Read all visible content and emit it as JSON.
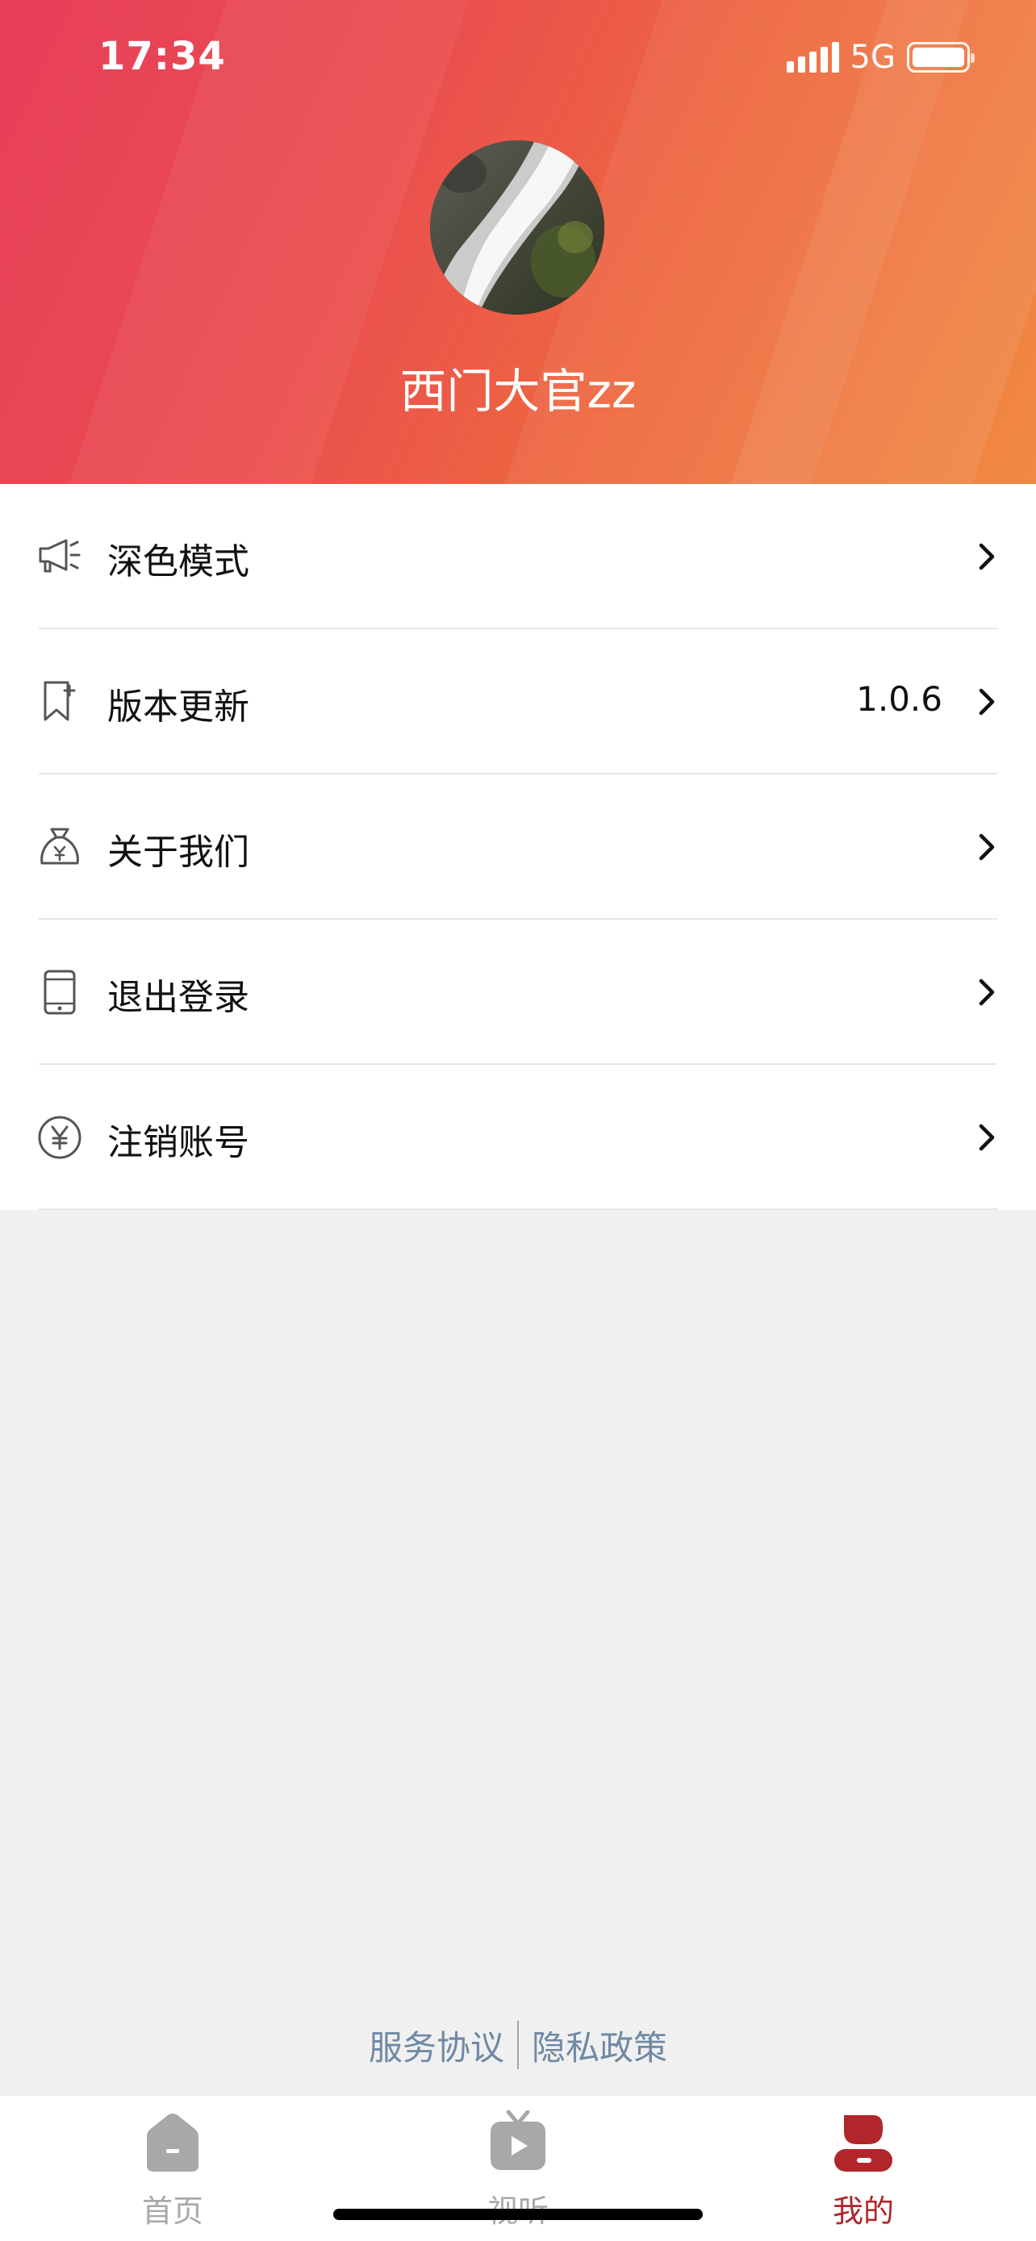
{
  "status_bar": {
    "time": "17:34",
    "network": "5G"
  },
  "profile": {
    "username": "西门大官zz",
    "avatar_icon": "avatar-waterfall-photo"
  },
  "menu": {
    "items": [
      {
        "label": "深色模式",
        "icon": "megaphone-icon",
        "value": ""
      },
      {
        "label": "版本更新",
        "icon": "bookmark-plus-icon",
        "value": "1.0.6"
      },
      {
        "label": "关于我们",
        "icon": "money-bag-icon",
        "value": ""
      },
      {
        "label": "退出登录",
        "icon": "phone-icon",
        "value": ""
      },
      {
        "label": "注销账号",
        "icon": "yen-circle-icon",
        "value": ""
      }
    ]
  },
  "footer": {
    "terms": "服务协议",
    "privacy": "隐私政策"
  },
  "tabbar": {
    "tabs": [
      {
        "label": "首页",
        "icon": "home-icon",
        "active": false
      },
      {
        "label": "视听",
        "icon": "tv-play-icon",
        "active": false
      },
      {
        "label": "我的",
        "icon": "profile-icon",
        "active": true
      }
    ]
  },
  "colors": {
    "header_start": "#e83e5a",
    "header_end": "#f08a43",
    "accent": "#b0262a",
    "footer_link": "#7089a3",
    "tab_inactive": "#a8a8a8"
  }
}
